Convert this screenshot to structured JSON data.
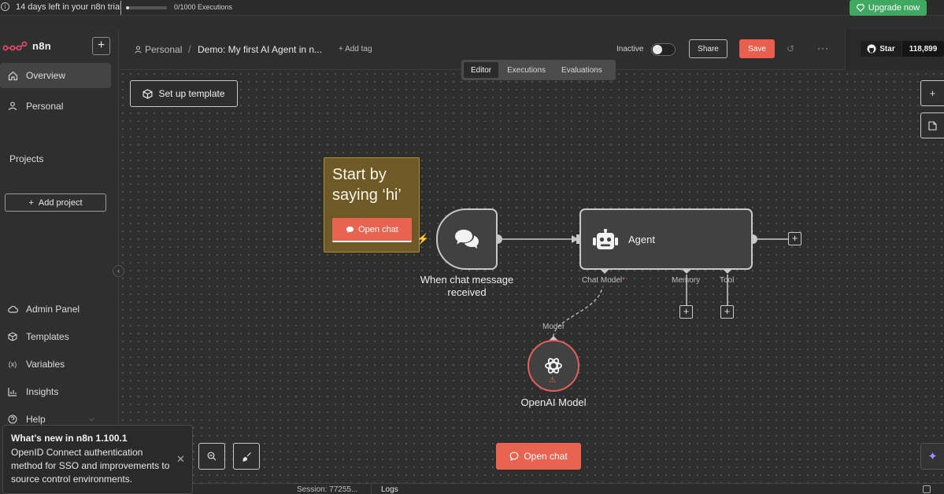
{
  "trial": {
    "text": "14 days left in your n8n trial",
    "executions": "0/1000 Executions",
    "executions_used_fraction": 0.0,
    "upgrade_label": "Upgrade now"
  },
  "sidebar": {
    "logo": "n8n",
    "new_button": "+",
    "items": [
      {
        "label": "Overview",
        "icon": "home-icon"
      },
      {
        "label": "Personal",
        "icon": "user-icon"
      }
    ],
    "projects_label": "Projects",
    "add_project_label": "Add project",
    "bottom_items": [
      {
        "label": "Admin Panel",
        "icon": "cloud-icon"
      },
      {
        "label": "Templates",
        "icon": "box-icon"
      },
      {
        "label": "Variables",
        "icon": "variable-icon"
      },
      {
        "label": "Insights",
        "icon": "chart-icon"
      },
      {
        "label": "Help",
        "icon": "help-icon"
      }
    ]
  },
  "whats_new": {
    "title": "What's new in n8n 1.100.1",
    "body": "OpenID Connect authentication method for SSO and improvements to source control environments."
  },
  "header": {
    "breadcrumb_personal": "Personal",
    "breadcrumb_separator": "/",
    "workflow_name": "Demo: My first AI Agent in n...",
    "add_tag": "+ Add tag",
    "status_label": "Inactive",
    "share_label": "Share",
    "save_label": "Save",
    "more_label": "···",
    "github_star_label": "Star",
    "github_star_count": "118,899"
  },
  "tabs": [
    {
      "label": "Editor",
      "active": true
    },
    {
      "label": "Executions",
      "active": false
    },
    {
      "label": "Evaluations",
      "active": false
    }
  ],
  "canvas": {
    "setup_template_label": "Set up template",
    "sticky_note": {
      "title": "Start by saying ‘hi’",
      "button_label": "Open chat"
    },
    "trigger_node": {
      "label": "When chat message received"
    },
    "agent_node": {
      "label": "Agent",
      "sub_inputs": [
        {
          "label": "Chat Model",
          "required_mark": "*"
        },
        {
          "label": "Memory",
          "required_mark": ""
        },
        {
          "label": "Tool",
          "required_mark": ""
        }
      ]
    },
    "model_connector_label": "Model",
    "openai_node": {
      "label": "OpenAI Model"
    },
    "open_chat_label": "Open chat"
  },
  "bottom_bar": {
    "session": "Session: 77255...",
    "logs": "Logs"
  },
  "colors": {
    "accent": "#e86450",
    "upgrade": "#3fa861",
    "sticky": "#6e5a26",
    "node_border": "#c8c8c8"
  }
}
